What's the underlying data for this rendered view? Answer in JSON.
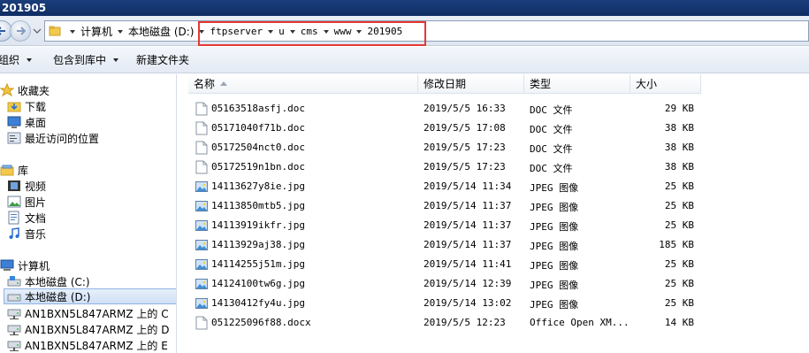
{
  "window": {
    "title": "201905"
  },
  "address": {
    "crumbs": [
      {
        "label": "计算机"
      },
      {
        "label": "本地磁盘 (D:)"
      },
      {
        "label": "ftpserver"
      },
      {
        "label": "u"
      },
      {
        "label": "cms"
      },
      {
        "label": "www"
      },
      {
        "label": "201905"
      }
    ]
  },
  "toolbar": {
    "organize": "组织",
    "include_library": "包含到库中",
    "new_folder": "新建文件夹"
  },
  "nav": {
    "favorites": "收藏夹",
    "downloads": "下载",
    "desktop": "桌面",
    "recent": "最近访问的位置",
    "libraries": "库",
    "videos": "视频",
    "pictures": "图片",
    "documents": "文档",
    "music": "音乐",
    "computer": "计算机",
    "drive_c": "本地磁盘 (C:)",
    "drive_d": "本地磁盘 (D:)",
    "net_c": "AN1BXN5L847ARMZ 上的 C",
    "net_d": "AN1BXN5L847ARMZ 上的 D",
    "net_e": "AN1BXN5L847ARMZ 上的 E"
  },
  "columns": {
    "name": "名称",
    "modified": "修改日期",
    "type": "类型",
    "size": "大小"
  },
  "files": [
    {
      "name": "05163518asfj.doc",
      "date": "2019/5/5 16:33",
      "type": "DOC 文件",
      "size": "29 KB",
      "kind": "doc"
    },
    {
      "name": "05171040f71b.doc",
      "date": "2019/5/5 17:08",
      "type": "DOC 文件",
      "size": "38 KB",
      "kind": "doc"
    },
    {
      "name": "05172504nct0.doc",
      "date": "2019/5/5 17:23",
      "type": "DOC 文件",
      "size": "38 KB",
      "kind": "doc"
    },
    {
      "name": "05172519n1bn.doc",
      "date": "2019/5/5 17:23",
      "type": "DOC 文件",
      "size": "38 KB",
      "kind": "doc"
    },
    {
      "name": "14113627y8ie.jpg",
      "date": "2019/5/14 11:34",
      "type": "JPEG 图像",
      "size": "25 KB",
      "kind": "jpg"
    },
    {
      "name": "14113850mtb5.jpg",
      "date": "2019/5/14 11:37",
      "type": "JPEG 图像",
      "size": "25 KB",
      "kind": "jpg"
    },
    {
      "name": "14113919ikfr.jpg",
      "date": "2019/5/14 11:37",
      "type": "JPEG 图像",
      "size": "25 KB",
      "kind": "jpg"
    },
    {
      "name": "14113929aj38.jpg",
      "date": "2019/5/14 11:37",
      "type": "JPEG 图像",
      "size": "185 KB",
      "kind": "jpg"
    },
    {
      "name": "14114255j51m.jpg",
      "date": "2019/5/14 11:41",
      "type": "JPEG 图像",
      "size": "25 KB",
      "kind": "jpg"
    },
    {
      "name": "14124100tw6g.jpg",
      "date": "2019/5/14 12:39",
      "type": "JPEG 图像",
      "size": "25 KB",
      "kind": "jpg"
    },
    {
      "name": "14130412fy4u.jpg",
      "date": "2019/5/14 13:02",
      "type": "JPEG 图像",
      "size": "25 KB",
      "kind": "jpg"
    },
    {
      "name": "051225096f88.docx",
      "date": "2019/5/5 12:23",
      "type": "Office Open XM...",
      "size": "14 KB",
      "kind": "doc"
    }
  ],
  "colors": {
    "highlight": "#e53935",
    "titlebar": "#1b3f7c"
  }
}
